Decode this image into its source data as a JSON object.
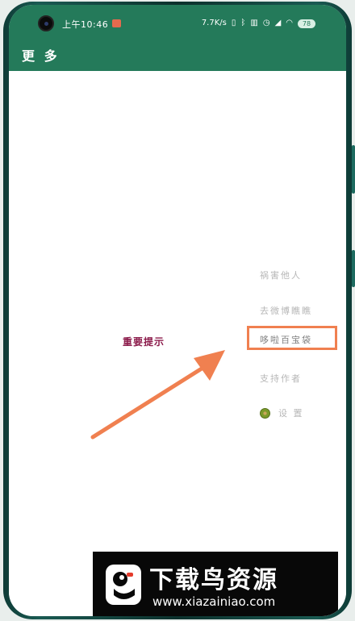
{
  "status_bar": {
    "time": "上午10:46",
    "speed": "7.7K/s",
    "battery": "78"
  },
  "header": {
    "title": "更 多"
  },
  "notice": {
    "label": "重要提示"
  },
  "menu": {
    "items": [
      {
        "label": "祸害他人"
      },
      {
        "label": "去微博瞧瞧"
      },
      {
        "label": "哆啦百宝袋"
      },
      {
        "label": "支持作者"
      },
      {
        "label": "设 置",
        "icon": "kiwi-icon"
      }
    ]
  },
  "annotation": {
    "color": "#f08050"
  },
  "watermark": {
    "title": "下载鸟资源",
    "url": "www.xiazainiao.com"
  },
  "colors": {
    "header": "#247a5a",
    "notice_text": "#8b1a4a",
    "menu_text": "#b7b7b7"
  }
}
